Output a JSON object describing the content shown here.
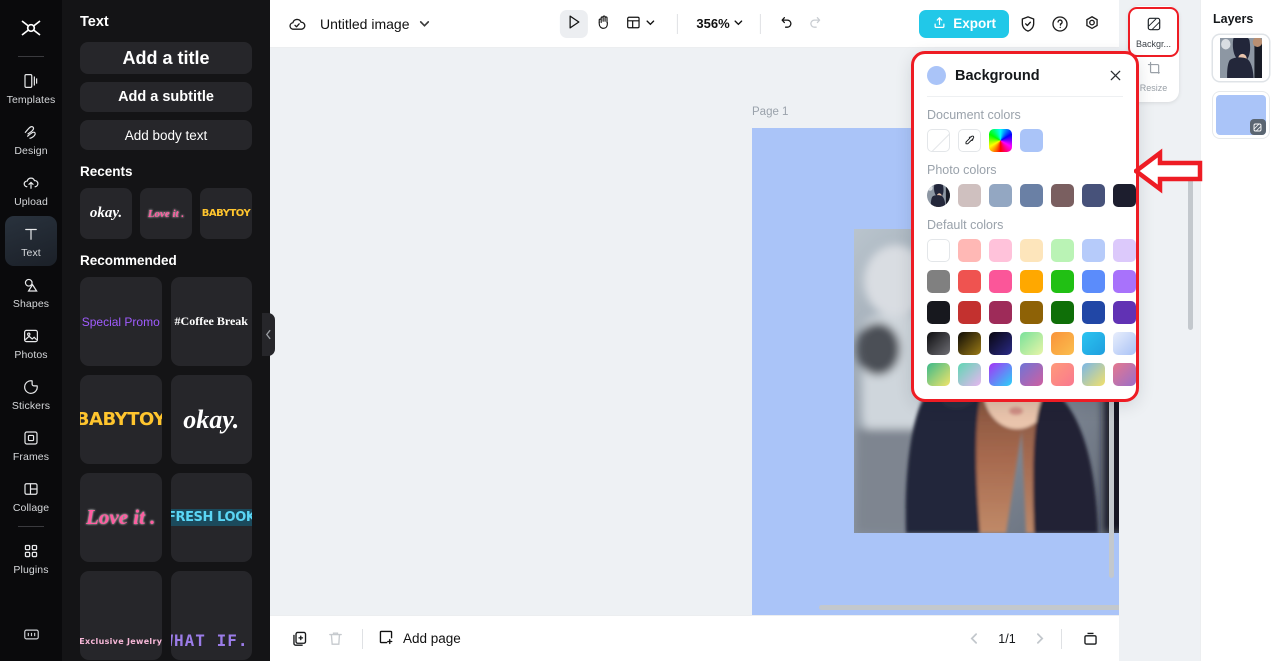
{
  "rail": {
    "logo_icon": "capcut-logo-icon",
    "items": [
      {
        "label": "Templates",
        "icon": "templates-icon"
      },
      {
        "label": "Design",
        "icon": "design-icon"
      },
      {
        "label": "Upload",
        "icon": "upload-cloud-icon"
      },
      {
        "label": "Text",
        "icon": "text-t-icon",
        "active": true
      },
      {
        "label": "Shapes",
        "icon": "shapes-icon"
      },
      {
        "label": "Photos",
        "icon": "photos-icon"
      },
      {
        "label": "Stickers",
        "icon": "stickers-icon"
      },
      {
        "label": "Frames",
        "icon": "frames-icon"
      },
      {
        "label": "Collage",
        "icon": "collage-icon"
      },
      {
        "label": "Plugins",
        "icon": "plugins-icon"
      }
    ],
    "bottom_icon": "keyboard-icon"
  },
  "panel": {
    "title": "Text",
    "buttons": [
      {
        "label": "Add a title"
      },
      {
        "label": "Add a subtitle"
      },
      {
        "label": "Add body text"
      }
    ],
    "recents_heading": "Recents",
    "recents": [
      {
        "label": "okay.",
        "style": "s-okay"
      },
      {
        "label": "Love it .",
        "style": "s-love"
      },
      {
        "label": "BABYTOY",
        "style": "s-baby"
      }
    ],
    "recommended_heading": "Recommended",
    "recommended": [
      {
        "label": "Special Promo",
        "style": "s-promo",
        "size": "12px"
      },
      {
        "label": "#Coffee Break",
        "style": "s-coffee",
        "size": "12px"
      },
      {
        "label": "BABYTOY",
        "style": "s-baby",
        "size": "19px"
      },
      {
        "label": "okay.",
        "style": "s-okay",
        "size": "26px"
      },
      {
        "label": "Love it .",
        "style": "s-love",
        "size": "22px"
      },
      {
        "label": "FRESH LOOK",
        "style": "s-fresh",
        "size": "14px"
      },
      {
        "label": "Exclusive Jewelry",
        "style": "s-jewel",
        "size": "8px"
      },
      {
        "label": "WHAT IF..",
        "style": "s-what",
        "size": "17px"
      }
    ]
  },
  "topbar": {
    "cloud_icon": "cloud-saved-icon",
    "doc_name": "Untitled image",
    "doc_chevron_icon": "chevron-down-icon",
    "select_tool_icon": "cursor-select-icon",
    "hand_tool_icon": "hand-pan-icon",
    "layout_tool_icon": "layout-grid-icon",
    "layout_chevron_icon": "chevron-down-icon",
    "zoom_value": "356%",
    "zoom_chevron_icon": "chevron-down-icon",
    "undo_icon": "undo-arrow-icon",
    "redo_icon": "redo-arrow-icon",
    "export_label": "Export",
    "export_icon": "upload-share-icon",
    "export_color": "#21c8e8",
    "shield_icon": "shield-check-icon",
    "help_icon": "question-circle-icon",
    "settings_icon": "gear-icon"
  },
  "canvas": {
    "page_label": "Page 1",
    "page_bg_color": "#aac4f8",
    "photo_alt": "woman-in-dark-hoodie-photo"
  },
  "bottombar": {
    "duplicate_icon": "duplicate-page-icon",
    "delete_icon": "trash-icon",
    "add_page_label": "Add page",
    "add_page_icon": "add-page-icon",
    "prev_icon": "chevron-left-icon",
    "page_indicator": "1/1",
    "next_icon": "chevron-right-icon",
    "grid_view_icon": "page-thumbnails-icon"
  },
  "right_tools": {
    "items": [
      {
        "label": "Backgr...",
        "icon": "background-swatch-icon",
        "highlighted": true
      },
      {
        "label": "Resize",
        "icon": "resize-crop-icon",
        "highlighted": false
      }
    ]
  },
  "layers": {
    "title": "Layers",
    "items": [
      {
        "name": "photo-layer",
        "type": "image"
      },
      {
        "name": "background-layer",
        "type": "color",
        "color": "#aac4f8",
        "badge_icon": "background-swatch-icon"
      }
    ]
  },
  "background_panel": {
    "title": "Background",
    "swatch_color": "#aac4f8",
    "close_icon": "close-x-icon",
    "document_colors_label": "Document colors",
    "document_colors": [
      {
        "name": "no-color-swatch",
        "type": "none"
      },
      {
        "name": "eyedropper-swatch",
        "type": "picker",
        "icon": "eyedropper-icon"
      },
      {
        "name": "color-wheel-swatch",
        "type": "wheel"
      },
      {
        "name": "document-color-1",
        "type": "solid",
        "color": "#aac4f8"
      }
    ],
    "photo_colors_label": "Photo colors",
    "photo_colors": [
      {
        "name": "photo-source-thumb",
        "type": "photo"
      },
      {
        "name": "photo-color-1",
        "type": "solid",
        "color": "#cfc0bf"
      },
      {
        "name": "photo-color-2",
        "type": "solid",
        "color": "#93a7c2"
      },
      {
        "name": "photo-color-3",
        "type": "solid",
        "color": "#6a80a5"
      },
      {
        "name": "photo-color-4",
        "type": "solid",
        "color": "#7a5f60"
      },
      {
        "name": "photo-color-5",
        "type": "solid",
        "color": "#47527a"
      },
      {
        "name": "photo-color-6",
        "type": "solid",
        "color": "#1d1e2e"
      }
    ],
    "default_colors_label": "Default colors",
    "default_colors": [
      {
        "name": "default-color-white",
        "type": "solid",
        "color": "#ffffff",
        "bordered": true
      },
      {
        "name": "default-color-light-salmon",
        "type": "solid",
        "color": "#ffb8b5"
      },
      {
        "name": "default-color-light-pink",
        "type": "solid",
        "color": "#ffc2da"
      },
      {
        "name": "default-color-light-cream",
        "type": "solid",
        "color": "#fde5bb"
      },
      {
        "name": "default-color-light-green",
        "type": "solid",
        "color": "#baf3b5"
      },
      {
        "name": "default-color-light-blue",
        "type": "solid",
        "color": "#b6cbfa"
      },
      {
        "name": "default-color-light-purple",
        "type": "solid",
        "color": "#dcc9fb"
      },
      {
        "name": "default-color-gray",
        "type": "solid",
        "color": "#808080"
      },
      {
        "name": "default-color-red",
        "type": "solid",
        "color": "#ef5350"
      },
      {
        "name": "default-color-magenta",
        "type": "solid",
        "color": "#fb5699"
      },
      {
        "name": "default-color-orange",
        "type": "solid",
        "color": "#ffa800"
      },
      {
        "name": "default-color-green",
        "type": "solid",
        "color": "#21c014"
      },
      {
        "name": "default-color-blue",
        "type": "solid",
        "color": "#5b8cfb"
      },
      {
        "name": "default-color-purple",
        "type": "solid",
        "color": "#a872fb"
      },
      {
        "name": "default-color-black",
        "type": "solid",
        "color": "#17181e"
      },
      {
        "name": "default-color-dark-red",
        "type": "solid",
        "color": "#c3312f"
      },
      {
        "name": "default-color-dark-pink",
        "type": "solid",
        "color": "#9e2b59"
      },
      {
        "name": "default-color-dark-gold",
        "type": "solid",
        "color": "#8e6206"
      },
      {
        "name": "default-color-dark-green",
        "type": "solid",
        "color": "#0f6f08"
      },
      {
        "name": "default-color-dark-blue",
        "type": "solid",
        "color": "#2147a6"
      },
      {
        "name": "default-color-dark-purple",
        "type": "solid",
        "color": "#6132b4"
      },
      {
        "name": "default-gradient-black-gray",
        "type": "gradient",
        "from": "#0d0d0f",
        "to": "#6e6e74"
      },
      {
        "name": "default-gradient-black-gold",
        "type": "gradient",
        "from": "#0f0c06",
        "to": "#9a7a16"
      },
      {
        "name": "default-gradient-black-navy",
        "type": "gradient",
        "from": "#08060f",
        "to": "#2a2a86"
      },
      {
        "name": "default-gradient-green-mint",
        "type": "gradient",
        "from": "#79e19a",
        "to": "#e8f5a8"
      },
      {
        "name": "default-gradient-orange-yellow",
        "type": "gradient",
        "from": "#f9933a",
        "to": "#fbbe4e"
      },
      {
        "name": "default-gradient-cyan-blue",
        "type": "gradient",
        "from": "#2bc4f0",
        "to": "#1f9ede"
      },
      {
        "name": "default-gradient-white-blue",
        "type": "gradient",
        "from": "#e8eefc",
        "to": "#a9c2f6"
      },
      {
        "name": "default-gradient-green-yellow",
        "type": "gradient",
        "from": "#3cb98a",
        "to": "#f2e46a"
      },
      {
        "name": "default-gradient-mint-lilac",
        "type": "gradient",
        "from": "#5fd6b3",
        "to": "#e7b6f0"
      },
      {
        "name": "default-gradient-violet-cyan",
        "type": "gradient",
        "from": "#a633f5",
        "to": "#2ad2f8"
      },
      {
        "name": "default-gradient-purple-rose",
        "type": "gradient",
        "from": "#6f74d6",
        "to": "#cf5fa0"
      },
      {
        "name": "default-gradient-coral-pink",
        "type": "gradient",
        "from": "#ff9a7a",
        "to": "#f9788f"
      },
      {
        "name": "default-gradient-blue-yellow",
        "type": "gradient",
        "from": "#7ab7e8",
        "to": "#f2e06a"
      },
      {
        "name": "default-gradient-rose-violet",
        "type": "gradient",
        "from": "#e5788e",
        "to": "#9a6ec9"
      }
    ]
  },
  "annotations": {
    "highlight_color": "#ee1c24",
    "arrow_name": "red-pointer-arrow",
    "box_background_tool": "red-highlight-box-background-tool",
    "box_panel": "red-highlight-box-background-panel"
  }
}
